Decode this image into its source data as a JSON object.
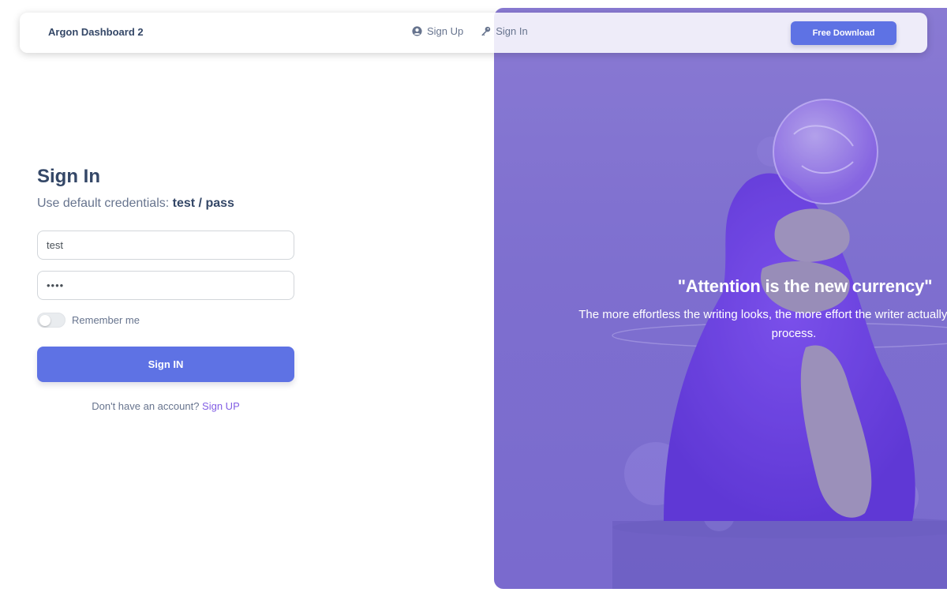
{
  "navbar": {
    "brand": "Argon Dashboard 2",
    "links": [
      {
        "label": "Sign Up",
        "icon": "user-circle-icon"
      },
      {
        "label": "Sign In",
        "icon": "key-icon"
      }
    ],
    "cta_label": "Free Download"
  },
  "signin": {
    "title": "Sign In",
    "subtitle_prefix": "Use default credentials: ",
    "subtitle_credentials": "test / pass",
    "username_value": "test",
    "password_value": "pass",
    "remember_label": "Remember me",
    "remember_checked": false,
    "submit_label": "Sign IN",
    "no_account_text": "Don't have an account? ",
    "signup_link": "Sign UP"
  },
  "hero": {
    "quote": "\"Attention is the new currency\"",
    "text": "The more effortless the writing looks, the more effort the writer actually put into the process."
  },
  "colors": {
    "primary": "#5e72e4",
    "link": "#825ee4",
    "heading": "#344767",
    "muted": "#67748e",
    "hero": "#7f72cf"
  }
}
